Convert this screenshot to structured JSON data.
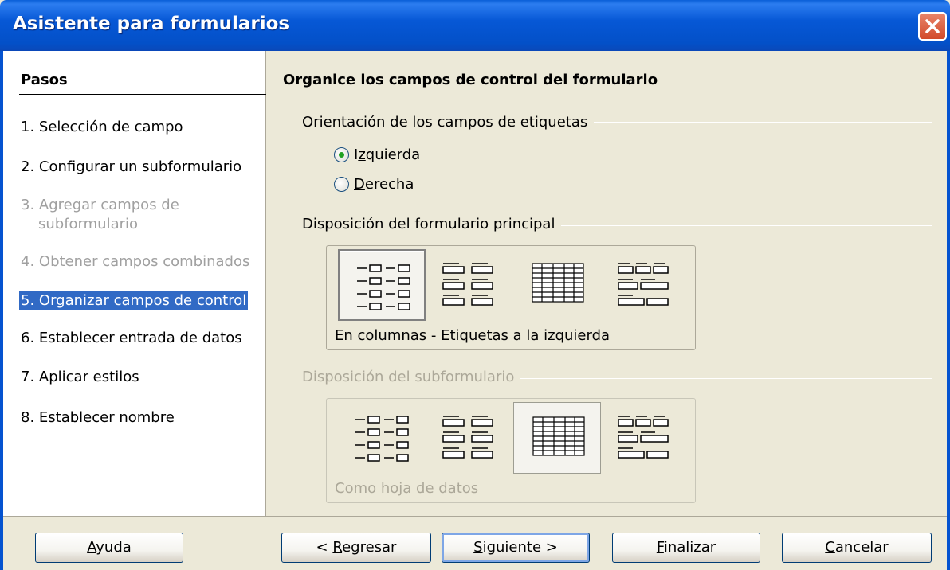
{
  "window": {
    "title": "Asistente para formularios"
  },
  "sidebar": {
    "title": "Pasos",
    "steps": [
      {
        "label": "1. Selección de campo",
        "state": "normal"
      },
      {
        "label": "2. Configurar un subformulario",
        "state": "normal"
      },
      {
        "label": "3. Agregar campos de",
        "label2": "subformulario",
        "state": "disabled"
      },
      {
        "label": "4. Obtener campos combinados",
        "state": "disabled"
      },
      {
        "label": "5. Organizar campos de control",
        "state": "active"
      },
      {
        "label": "6. Establecer entrada de datos",
        "state": "normal"
      },
      {
        "label": "7. Aplicar estilos",
        "state": "normal"
      },
      {
        "label": "8. Establecer nombre",
        "state": "normal"
      }
    ]
  },
  "main": {
    "heading": "Organice los campos de control del formulario",
    "orientation": {
      "label": "Orientación de los campos de etiquetas",
      "options": [
        {
          "accel": "I",
          "rest_pre": "",
          "text": "zquierda",
          "full": "Izquierda",
          "accel_char": "z",
          "checked": true
        },
        {
          "accel": "D",
          "text": "erecha",
          "full": "Derecha",
          "checked": false
        }
      ]
    },
    "main_layout": {
      "label": "Disposición del formulario principal",
      "caption": "En columnas - Etiquetas a la izquierda",
      "selected_index": 0
    },
    "sub_layout": {
      "label": "Disposición del subformulario",
      "caption": "Como hoja de datos",
      "selected_index": 2,
      "disabled": true
    }
  },
  "footer": {
    "help": {
      "accel": "A",
      "rest": "yuda"
    },
    "back": {
      "pre": "< ",
      "accel": "R",
      "rest": "egresar"
    },
    "next": {
      "accel": "S",
      "rest": "iguiente >"
    },
    "finish": {
      "accel": "F",
      "rest": "inalizar"
    },
    "cancel": {
      "accel": "C",
      "rest": "ancelar"
    }
  },
  "colors": {
    "title_bar": "#0758d6",
    "selection": "#316ac5",
    "disabled_text": "#a0a0a0",
    "radio_dot": "#21a121",
    "close_button": "#d24a2a"
  }
}
